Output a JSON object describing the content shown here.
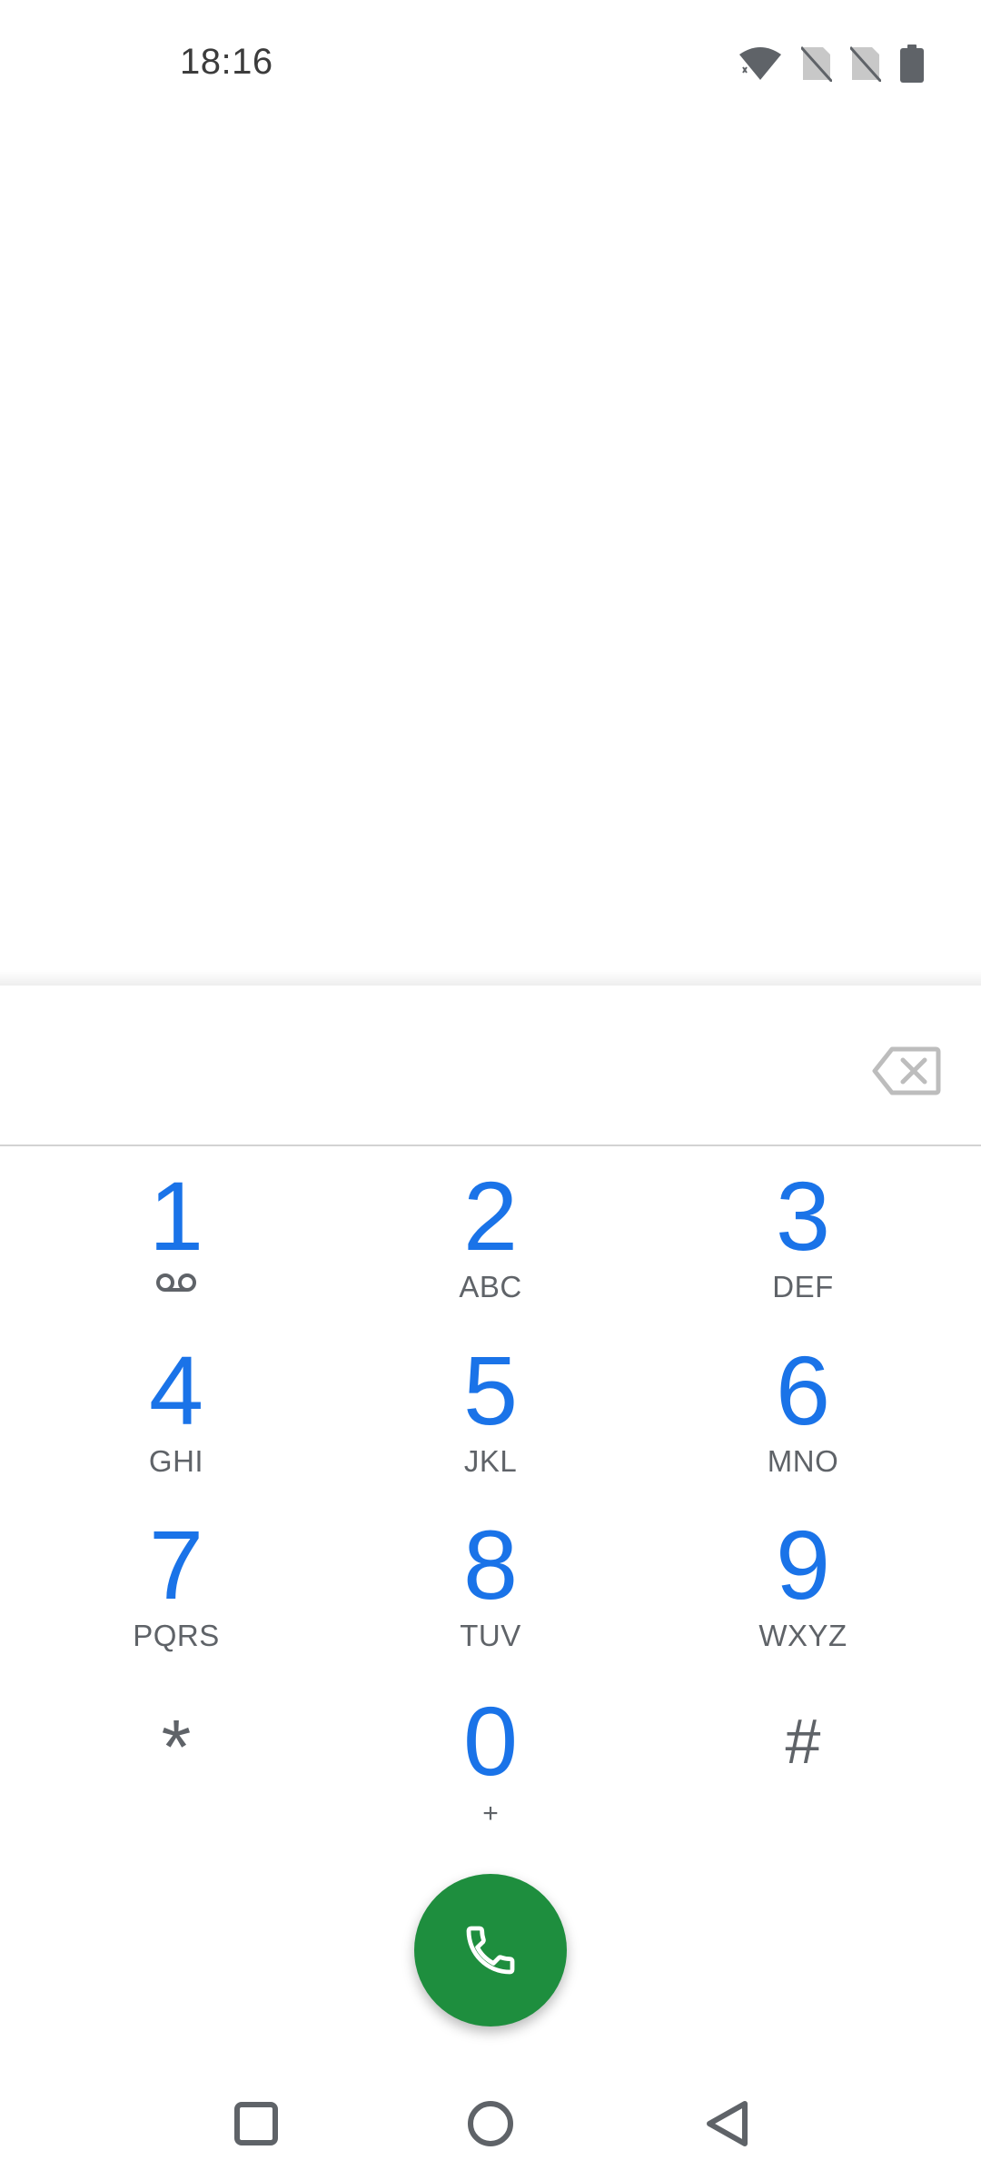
{
  "status_bar": {
    "time": "18:16",
    "icons": [
      "wifi-icon",
      "no-sim-icon",
      "no-sim-icon",
      "battery-icon"
    ]
  },
  "dialer": {
    "digits_value": "",
    "backspace_icon": "backspace-icon",
    "keys": [
      {
        "digit": "1",
        "letters": "",
        "sub_icon": "voicemail-icon"
      },
      {
        "digit": "2",
        "letters": "ABC"
      },
      {
        "digit": "3",
        "letters": "DEF"
      },
      {
        "digit": "4",
        "letters": "GHI"
      },
      {
        "digit": "5",
        "letters": "JKL"
      },
      {
        "digit": "6",
        "letters": "MNO"
      },
      {
        "digit": "7",
        "letters": "PQRS"
      },
      {
        "digit": "8",
        "letters": "TUV"
      },
      {
        "digit": "9",
        "letters": "WXYZ"
      },
      {
        "digit": "*",
        "letters": ""
      },
      {
        "digit": "0",
        "letters": "+"
      },
      {
        "digit": "#",
        "letters": ""
      }
    ],
    "call_icon": "phone-icon"
  },
  "navigation": {
    "items": [
      "recents-square-icon",
      "home-circle-icon",
      "back-triangle-icon"
    ]
  },
  "colors": {
    "digit_blue": "#1a73e8",
    "letters_gray": "#5f6368",
    "call_green": "#1e8e3e",
    "divider": "#d3d3d3"
  }
}
